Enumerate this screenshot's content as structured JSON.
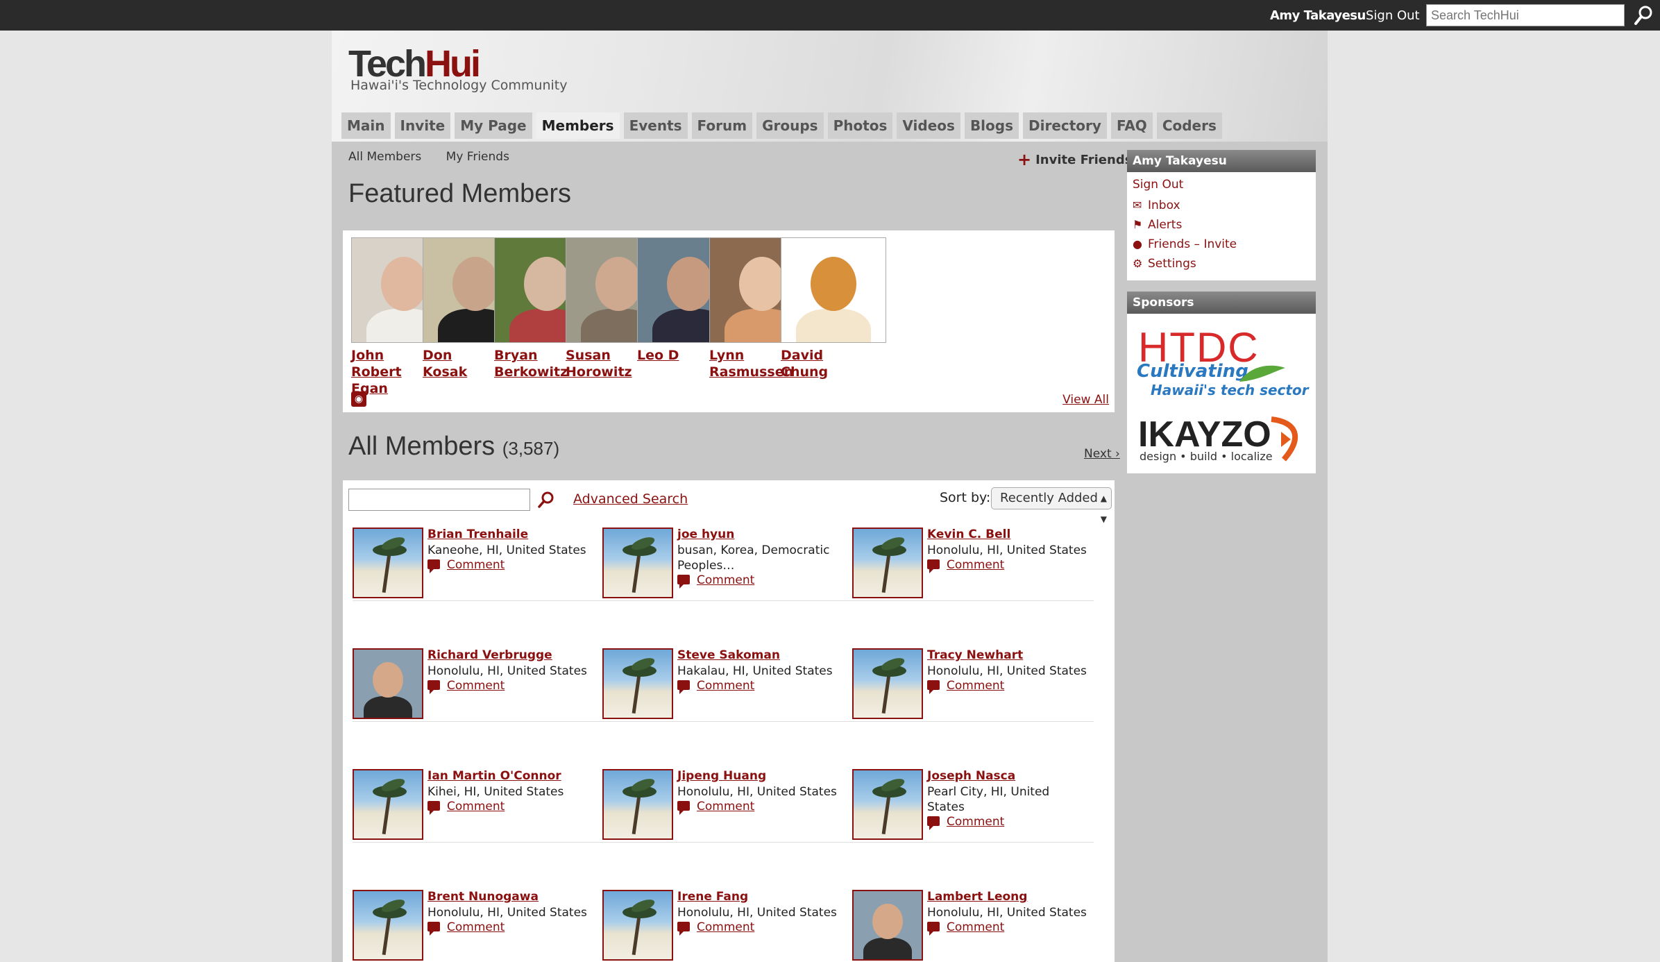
{
  "topbar": {
    "user_name": "Amy Takayesu",
    "sign_out": "Sign Out",
    "search_placeholder": "Search TechHui"
  },
  "header": {
    "logo_tech": "Tech",
    "logo_hui": "Hui",
    "tagline": "Hawai'i's Technology Community"
  },
  "nav": [
    {
      "label": "Main"
    },
    {
      "label": "Invite"
    },
    {
      "label": "My Page"
    },
    {
      "label": "Members",
      "active": true
    },
    {
      "label": "Events"
    },
    {
      "label": "Forum"
    },
    {
      "label": "Groups"
    },
    {
      "label": "Photos"
    },
    {
      "label": "Videos"
    },
    {
      "label": "Blogs"
    },
    {
      "label": "Directory"
    },
    {
      "label": "FAQ"
    },
    {
      "label": "Coders"
    }
  ],
  "subnav": {
    "all_members": "All Members",
    "my_friends": "My Friends",
    "invite_friends": "Invite Friends"
  },
  "featured": {
    "title": "Featured Members",
    "view_all": "View All",
    "members": [
      {
        "name": "John Robert Egan"
      },
      {
        "name": "Don Kosak"
      },
      {
        "name": "Bryan Berkowitz"
      },
      {
        "name": "Susan Horowitz"
      },
      {
        "name": "Leo D"
      },
      {
        "name": "Lynn Rasmussen"
      },
      {
        "name": "David Chung"
      }
    ]
  },
  "all_members": {
    "title": "All Members",
    "count": "(3,587)",
    "next": "Next ›",
    "advanced_search": "Advanced Search",
    "sort_label": "Sort by:",
    "sort_value": "Recently Added",
    "comment_label": "Comment",
    "rows": [
      [
        {
          "name": "Brian Trenhaile",
          "location": "Kaneohe, HI, United States",
          "avatar": "palm"
        },
        {
          "name": "joe hyun",
          "location": "busan, Korea, Democratic Peoples…",
          "avatar": "palm"
        },
        {
          "name": "Kevin C. Bell",
          "location": "Honolulu, HI, United States",
          "avatar": "palm"
        }
      ],
      [
        {
          "name": "Richard Verbrugge",
          "location": "Honolulu, HI, United States",
          "avatar": "photo"
        },
        {
          "name": "Steve Sakoman",
          "location": "Hakalau, HI, United States",
          "avatar": "palm"
        },
        {
          "name": "Tracy Newhart",
          "location": "Honolulu, HI, United States",
          "avatar": "palm"
        }
      ],
      [
        {
          "name": "Ian Martin O'Connor",
          "location": "Kihei, HI, United States",
          "avatar": "palm"
        },
        {
          "name": "Jipeng Huang",
          "location": "Honolulu, HI, United States",
          "avatar": "palm"
        },
        {
          "name": "Joseph Nasca",
          "location": "Pearl City, HI, United States",
          "avatar": "palm"
        }
      ],
      [
        {
          "name": "Brent Nunogawa",
          "location": "Honolulu, HI, United States",
          "avatar": "palm"
        },
        {
          "name": "Irene Fang",
          "location": "Honolulu, HI, United States",
          "avatar": "palm"
        },
        {
          "name": "Lambert Leong",
          "location": "Honolulu, HI, United States",
          "avatar": "photo"
        }
      ]
    ]
  },
  "sidebar": {
    "user_title": "Amy Takayesu",
    "sign_out": "Sign Out",
    "links": [
      {
        "label": "Inbox",
        "icon": "envelope-icon"
      },
      {
        "label": "Alerts",
        "icon": "alert-flag-icon"
      },
      {
        "label": "Friends – Invite",
        "icon": "person-icon"
      },
      {
        "label": "Settings",
        "icon": "gear-icon"
      }
    ],
    "sponsors_title": "Sponsors",
    "htdc": "HTDC",
    "htdc_line1": "Cultivating",
    "htdc_line2": "Hawaii's tech sector",
    "ikayzo": "IKAYZO",
    "ikayzo_tag": "design • build • localize"
  },
  "colors": {
    "accent": "#8b1010",
    "topbar": "#2b2b2b",
    "page_bg": "#c8c8c8"
  }
}
